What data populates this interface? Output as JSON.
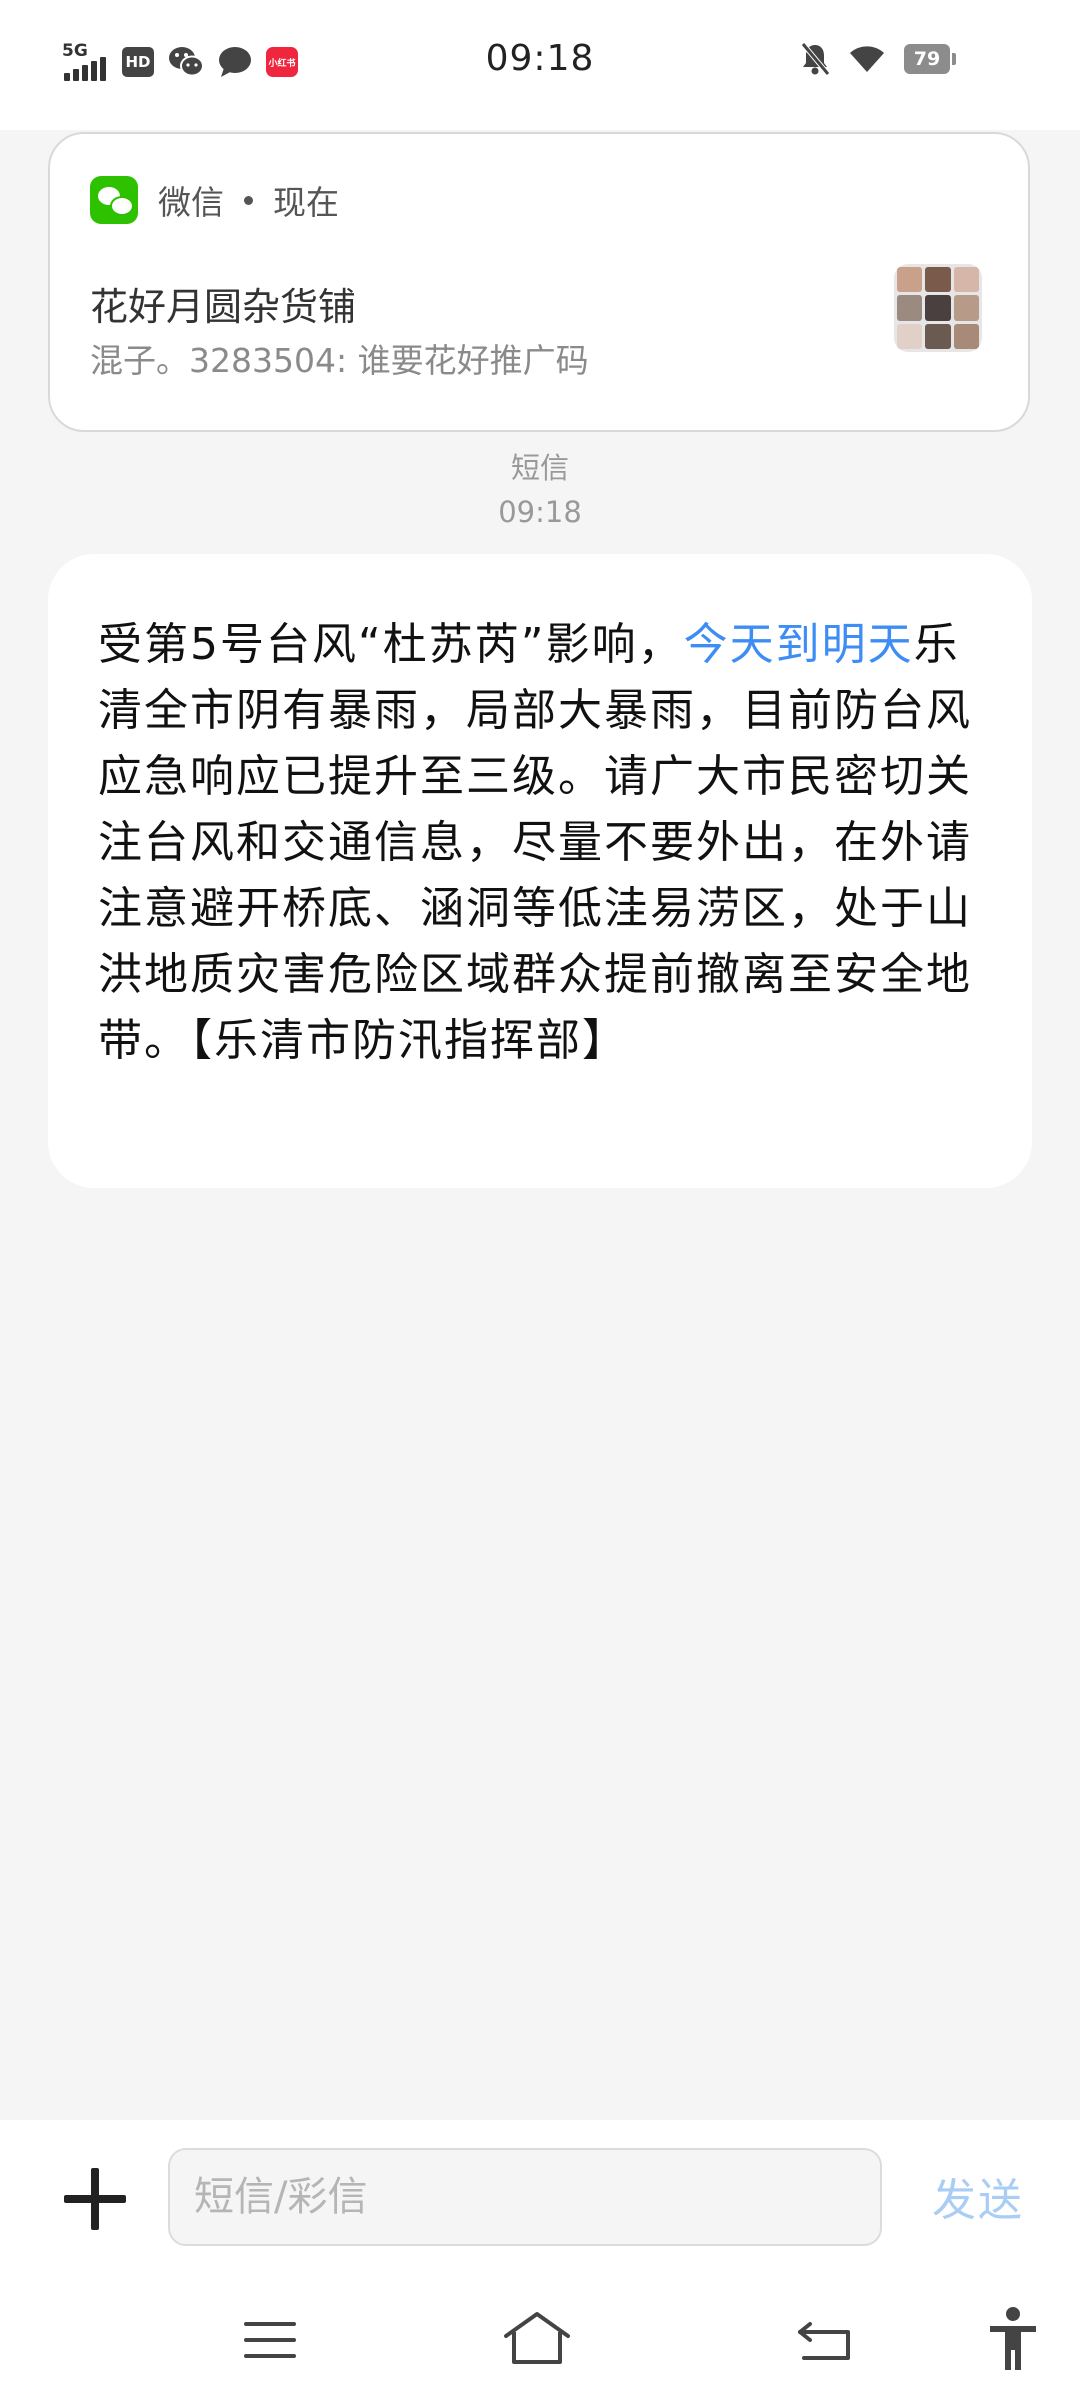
{
  "status_bar": {
    "network": "5G",
    "hd": "HD",
    "red_app_label": "小红书",
    "time": "09:18",
    "battery": "79"
  },
  "notification": {
    "app_name": "微信",
    "when": "现在",
    "title": "花好月圆杂货铺",
    "body": "混子。3283504: 谁要花好推广码",
    "thumb_colors": [
      "#c9a08a",
      "#7a5a4a",
      "#d6b6a8",
      "#9a8a80",
      "#4a4040",
      "#b89a88",
      "#e0d0c8",
      "#6a5a50",
      "#a88a78"
    ]
  },
  "message": {
    "source": "短信",
    "time": "09:18",
    "text_before": "受第5号台风“杜苏芮”影响，",
    "link": "今天到明天",
    "text_after": "乐清全市阴有暴雨，局部大暴雨，目前防台风应急响应已提升至三级。请广大市民密切关注台风和交通信息，尽量不要外出，在外请注意避开桥底、涵洞等低洼易涝区，处于山洪地质灾害危险区域群众提前撤离至安全地带。【乐清市防汛指挥部】"
  },
  "composer": {
    "placeholder": "短信/彩信",
    "send_label": "发送"
  },
  "colors": {
    "link": "#3d8df5",
    "send_disabled": "#a9cdf5",
    "wechat_green": "#2dc100",
    "background": "#f5f5f5"
  },
  "icons": [
    "signal-icon",
    "hd-icon",
    "wechat-icon",
    "chat-bubble-icon",
    "red-app-icon",
    "mute-bell-icon",
    "wifi-icon",
    "battery-icon",
    "plus-icon",
    "menu-icon",
    "home-icon",
    "back-icon",
    "accessibility-icon"
  ]
}
